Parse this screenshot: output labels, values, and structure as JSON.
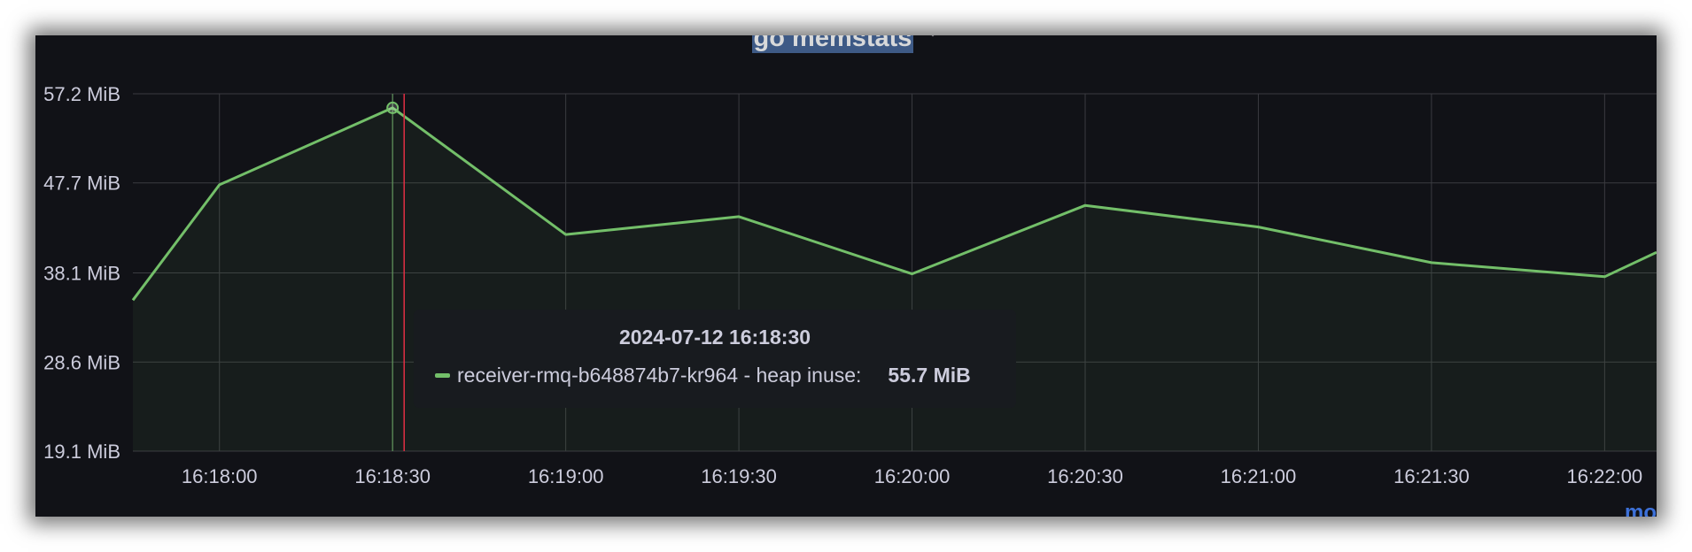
{
  "panel": {
    "title": "go memstats",
    "chevron_icon": "chevron-down-icon"
  },
  "tooltip": {
    "time": "2024-07-12 16:18:30",
    "series_label": "receiver-rmq-b648874b7-kr964 - heap inuse:",
    "value": "55.7 MiB"
  },
  "corner_link": "mo",
  "colors": {
    "background": "#111217",
    "grid": "#3a3b40",
    "series": "#73bf69",
    "hover_line": "#e02f44",
    "title_highlight": "#3e5a86",
    "tooltip_bg": "#181b1f"
  },
  "chart_data": {
    "type": "line",
    "title": "go memstats",
    "x": [
      "16:17:45",
      "16:18:00",
      "16:18:30",
      "16:19:00",
      "16:19:30",
      "16:20:00",
      "16:20:30",
      "16:21:00",
      "16:21:30",
      "16:22:00",
      "16:22:09"
    ],
    "x_ticks": [
      "16:18:00",
      "16:18:30",
      "16:19:00",
      "16:19:30",
      "16:20:00",
      "16:20:30",
      "16:21:00",
      "16:21:30",
      "16:22:00"
    ],
    "y_ticks": [
      "57.2 MiB",
      "47.7 MiB",
      "38.1 MiB",
      "28.6 MiB",
      "19.1 MiB"
    ],
    "y_unit": "MiB",
    "ylim": [
      19.1,
      57.2
    ],
    "xlim": [
      "16:17:45",
      "16:22:09"
    ],
    "series": [
      {
        "name": "receiver-rmq-b648874b7-kr964 - heap inuse",
        "values": [
          35.2,
          47.5,
          55.7,
          42.2,
          44.1,
          38.0,
          45.3,
          43.0,
          39.2,
          37.7,
          40.3
        ]
      }
    ],
    "hover": {
      "x": "16:18:30",
      "value": 55.7
    },
    "cursor_x": "16:18:32",
    "grid": true,
    "fill": "area"
  }
}
